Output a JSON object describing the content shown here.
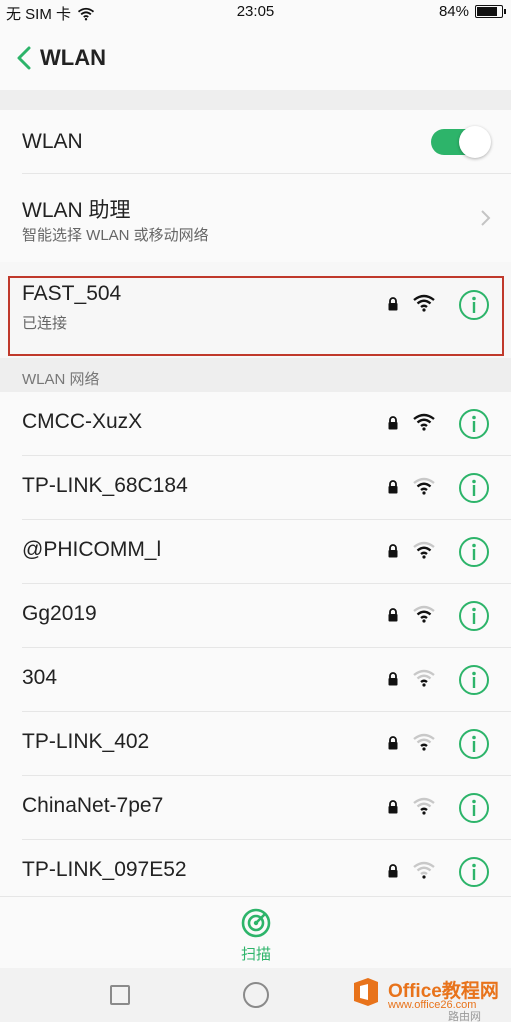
{
  "status_bar": {
    "carrier": "无 SIM 卡",
    "time": "23:05",
    "battery": "84%",
    "battery_level": 0.84
  },
  "header": {
    "title": "WLAN"
  },
  "wlan_toggle": {
    "label": "WLAN",
    "enabled": true
  },
  "assistant": {
    "title": "WLAN 助理",
    "subtitle": "智能选择 WLAN 或移动网络"
  },
  "connected": {
    "name": "FAST_504",
    "status": "已连接",
    "signal": 3
  },
  "section_label": "WLAN 网络",
  "networks": [
    {
      "name": "CMCC-XuzX",
      "signal": 3,
      "locked": true
    },
    {
      "name": "TP-LINK_68C184",
      "signal": 2,
      "locked": true
    },
    {
      "name": "@PHICOMM_l",
      "signal": 2,
      "locked": true
    },
    {
      "name": "Gg2019",
      "signal": 2,
      "locked": true
    },
    {
      "name": "304",
      "signal": 1,
      "locked": true
    },
    {
      "name": "TP-LINK_402",
      "signal": 1,
      "locked": true
    },
    {
      "name": "ChinaNet-7pe7",
      "signal": 1,
      "locked": true
    },
    {
      "name": "TP-LINK_097E52",
      "signal": 0,
      "locked": true
    }
  ],
  "scan_button": {
    "label": "扫描"
  },
  "watermark": {
    "brand": "Office教程网",
    "url": "www.office26.com",
    "sub": "路由网"
  },
  "colors": {
    "accent": "#2db46a",
    "highlight": "#c0392b",
    "watermark": "#e8731b"
  }
}
